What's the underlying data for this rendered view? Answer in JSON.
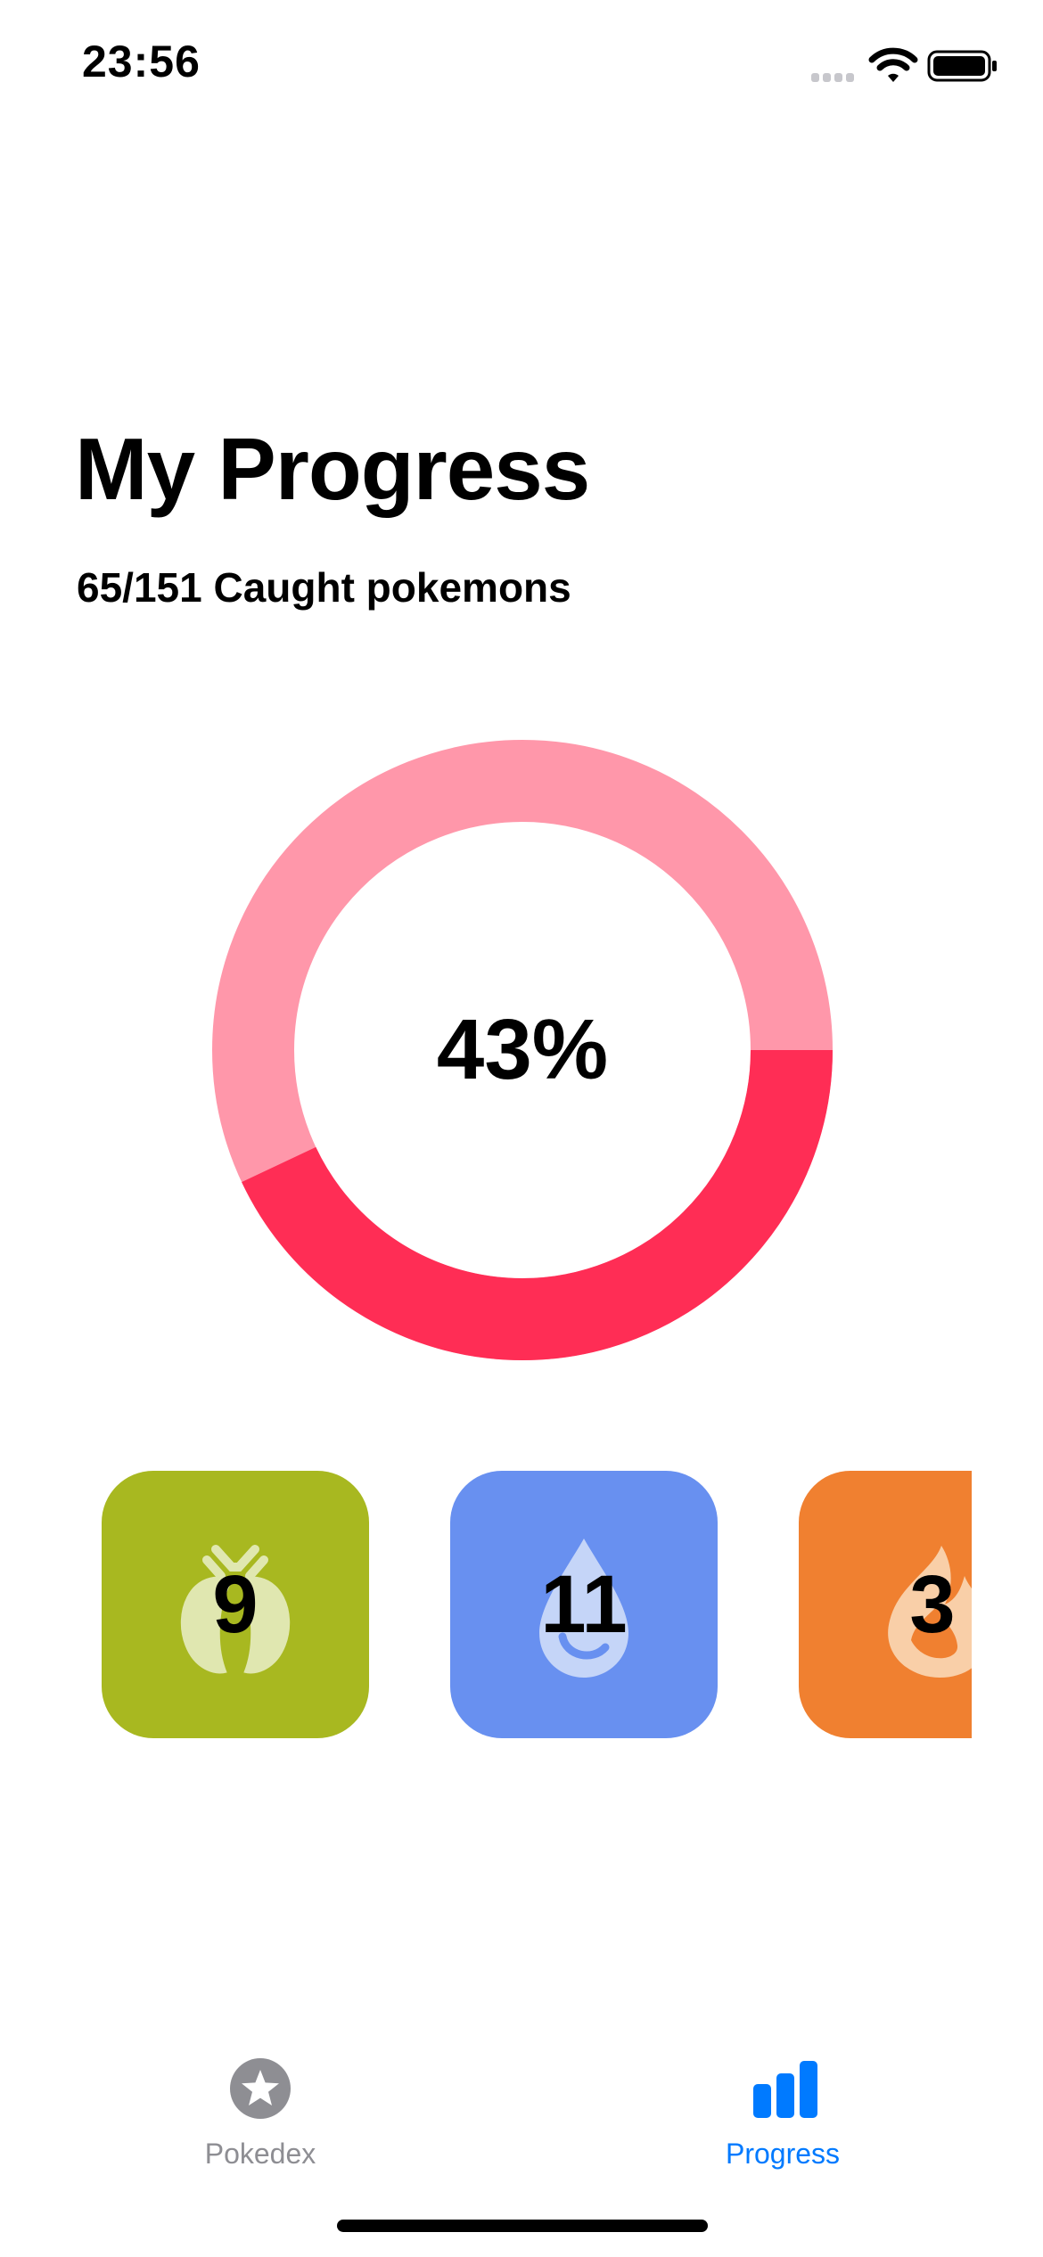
{
  "status_bar": {
    "time": "23:56"
  },
  "header": {
    "title": "My Progress",
    "subtitle": "65/151 Caught pokemons"
  },
  "progress": {
    "caught": 65,
    "total": 151,
    "percent_label": "43%",
    "fraction": 0.43,
    "ring_color": "#FF2D55",
    "track_color": "#FF97AA"
  },
  "types": [
    {
      "icon": "bug-type-icon",
      "count": "9",
      "color": "#A8B820",
      "icon_color": "#E0E7B0"
    },
    {
      "icon": "water-drop-type-icon",
      "count": "11",
      "color": "#6890F0",
      "icon_color": "#C5D5F8"
    },
    {
      "icon": "fire-type-icon",
      "count": "3",
      "color": "#F08030",
      "icon_color": "#F9CFA8"
    }
  ],
  "tab_bar": {
    "active_color": "#007AFF",
    "inactive_color": "#8E8E93",
    "tabs": [
      {
        "label": "Pokedex",
        "icon": "star-circle-icon",
        "active": false
      },
      {
        "label": "Progress",
        "icon": "bar-chart-icon",
        "active": true
      }
    ]
  }
}
